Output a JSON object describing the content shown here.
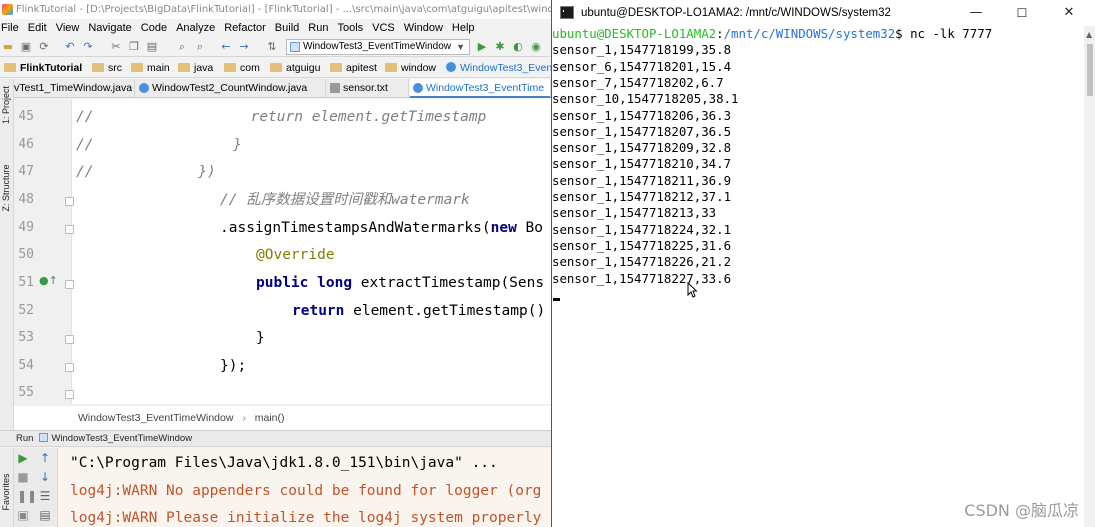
{
  "ide": {
    "title": "FlinkTutorial - [D:\\Projects\\BigData\\FlinkTutorial] - [FlinkTutorial] - ...\\src\\main\\java\\com\\atguigu\\apitest\\window\\W",
    "menu": [
      "File",
      "Edit",
      "View",
      "Navigate",
      "Code",
      "Analyze",
      "Refactor",
      "Build",
      "Run",
      "Tools",
      "VCS",
      "Window",
      "Help"
    ],
    "run_config": "WindowTest3_EventTimeWindow",
    "breadcrumbs": [
      "FlinkTutorial",
      "src",
      "main",
      "java",
      "com",
      "atguigu",
      "apitest",
      "window",
      "WindowTest3_Even"
    ],
    "tabs": [
      "vTest1_TimeWindow.java",
      "WindowTest2_CountWindow.java",
      "sensor.txt",
      "WindowTest3_EventTime"
    ],
    "side_labels": [
      "1: Project",
      "Z: Structure",
      "Favorites"
    ],
    "code_lines": [
      {
        "num": "45",
        "text": "//                  return element.getTimestamp"
      },
      {
        "num": "46",
        "text": "//                }"
      },
      {
        "num": "47",
        "text": "//            })"
      },
      {
        "num": "48",
        "comment": "// 乱序数据设置时间戳和watermark"
      },
      {
        "num": "49",
        "pre": ".assignTimestampsAndWatermarks(",
        "kw": "new",
        "post": " Bo"
      },
      {
        "num": "50",
        "ann": "@Override"
      },
      {
        "num": "51",
        "kw1": "public",
        "kw2": "long",
        "post": " extractTimestamp(Sens"
      },
      {
        "num": "52",
        "kw": "return",
        "post": " element.getTimestamp()"
      },
      {
        "num": "53",
        "text": "}"
      },
      {
        "num": "54",
        "text": "});"
      },
      {
        "num": "55",
        "text": ""
      }
    ],
    "structure_path": [
      "WindowTest3_EventTimeWindow",
      "main()"
    ],
    "run_tab_label": "Run",
    "run_tab_config": "WindowTest3_EventTimeWindow",
    "console_lines": [
      {
        "kind": "cmd",
        "text": "\"C:\\Program Files\\Java\\jdk1.8.0_151\\bin\\java\" ..."
      },
      {
        "kind": "warn",
        "text": "log4j:WARN No appenders could be found for logger (org"
      },
      {
        "kind": "warn",
        "text": "log4j:WARN Please initialize the log4j system properly"
      }
    ]
  },
  "terminal": {
    "title": "ubuntu@DESKTOP-LO1AMA2: /mnt/c/WINDOWS/system32",
    "window_controls": [
      "—",
      "☐",
      "✕"
    ],
    "prompt_user": "ubuntu@DESKTOP-LO1AMA2",
    "prompt_sep": ":",
    "prompt_path": "/mnt/c/WINDOWS/system32",
    "prompt_cmd": "$ nc -lk 7777",
    "lines": [
      "sensor_1,1547718199,35.8",
      "sensor_6,1547718201,15.4",
      "sensor_7,1547718202,6.7",
      "sensor_10,1547718205,38.1",
      "sensor_1,1547718206,36.3",
      "sensor_1,1547718207,36.5",
      "sensor_1,1547718209,32.8",
      "sensor_1,1547718210,34.7",
      "sensor_1,1547718211,36.9",
      "sensor_1,1547718212,37.1",
      "sensor_1,1547718213,33",
      "sensor_1,1547718224,32.1",
      "sensor_1,1547718225,31.6",
      "sensor_1,1547718226,21.2",
      "sensor_1,1547718227,33.6"
    ]
  },
  "watermark": "CSDN @脑瓜凉",
  "colors": {
    "prompt_user": "#25bc24",
    "prompt_path": "#2672d9",
    "warn": "#c0552c",
    "comment": "#808080",
    "keyword": "#000080",
    "annotation": "#808000"
  }
}
